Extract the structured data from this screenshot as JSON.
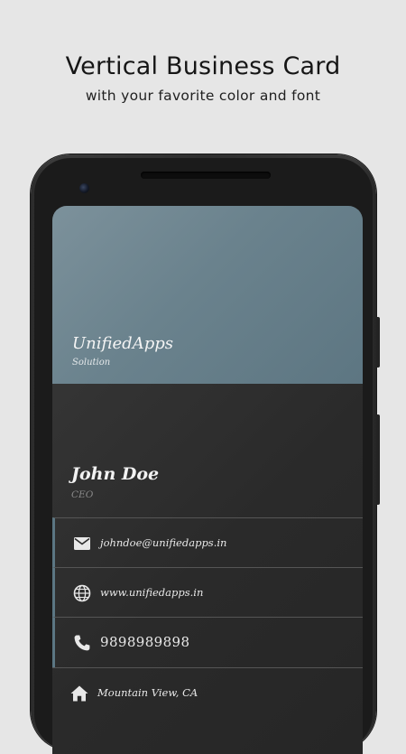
{
  "promo": {
    "headline": "Vertical Business Card",
    "subline": "with your favorite color and font"
  },
  "card": {
    "company": "UnifiedApps",
    "company_subtitle": "Solution",
    "name": "John Doe",
    "title": "CEO",
    "accent_color": "#6a828d",
    "contacts": [
      {
        "icon": "email-icon",
        "text": "johndoe@unifiedapps.in"
      },
      {
        "icon": "globe-icon",
        "text": "www.unifiedapps.in"
      },
      {
        "icon": "phone-icon",
        "text": "9898989898"
      },
      {
        "icon": "home-icon",
        "text": "Mountain View, CA"
      }
    ]
  }
}
